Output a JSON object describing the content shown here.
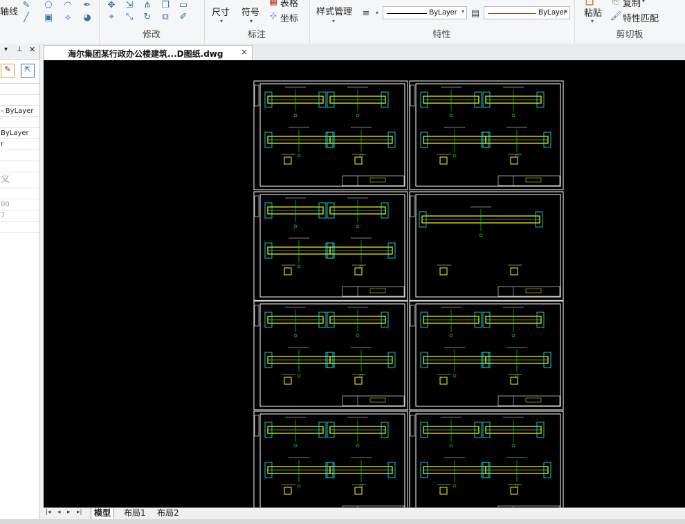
{
  "ribbon": {
    "partial_left_label": "轴线",
    "modify_label": "修改",
    "annotate": {
      "dimension": "尺寸",
      "symbol": "符号",
      "table": "表格",
      "coordinate": "坐标",
      "group_label": "标注"
    },
    "properties": {
      "style_manager": "样式管理",
      "linetype_value": "ByLayer",
      "color_value": "ByLayer",
      "group_label": "特性"
    },
    "clipboard": {
      "paste": "粘贴",
      "copy": "复制",
      "match_props": "特性匹配",
      "group_label": "剪切板"
    }
  },
  "left_panel": {
    "rows": [
      "",
      "",
      "- ByLayer",
      "",
      " ByLayer",
      "r",
      "",
      "",
      "义",
      "",
      "00",
      "7",
      ""
    ]
  },
  "document_tab": {
    "title": "海尔集团某行政办公楼建筑...D图纸.dwg",
    "close": "×"
  },
  "layout_tabs": [
    "模型",
    "布局1",
    "布局2"
  ],
  "colors": {
    "canvas": "#000000",
    "frame": "#ffffff",
    "yellow": "#ffff00",
    "cyan": "#00ffff",
    "green": "#00ff00",
    "red": "#ff3030"
  }
}
